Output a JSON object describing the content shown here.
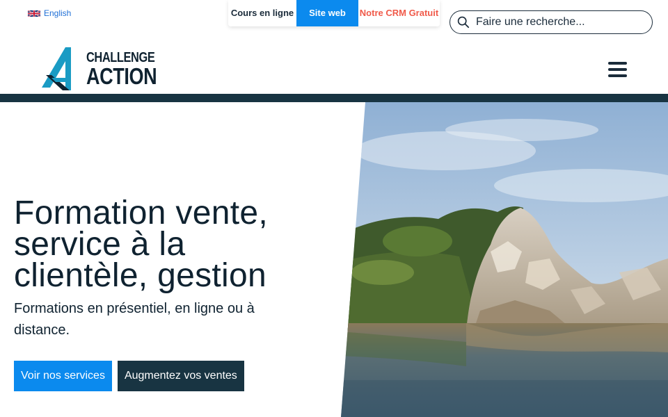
{
  "language_link": {
    "label": "English",
    "flag_icon": "uk-flag-icon"
  },
  "top_tabs": [
    {
      "label": "Cours en ligne"
    },
    {
      "label": "Site web"
    },
    {
      "label": "Notre CRM Gratuit"
    }
  ],
  "search": {
    "placeholder": "Faire une recherche...",
    "icon": "search-icon"
  },
  "logo": {
    "line1": "CHALLENGE",
    "line2": "ACTION"
  },
  "menu": {
    "icon": "hamburger-icon"
  },
  "hero": {
    "title": "Formation vente, service à la clientèle, gestion",
    "subtitle": "Formations en présentiel, en ligne ou à distance.",
    "primary_button": "Voir nos services",
    "secondary_button": "Augmentez vos ventes"
  },
  "colors": {
    "accent_blue": "#0b8aee",
    "dark_navy": "#183442",
    "crm_red": "#f05a4a",
    "logo_teal": "#1a9bc4"
  }
}
